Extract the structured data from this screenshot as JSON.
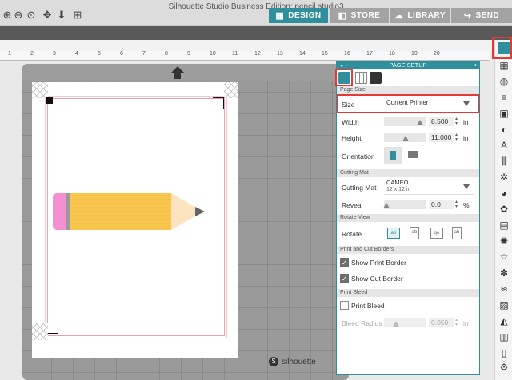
{
  "window": {
    "title": "Silhouette Studio Business Edition: pencil.studio3"
  },
  "toolbar_icons": [
    "zoom-in-icon",
    "zoom-out-icon",
    "zoom-select-icon",
    "pan-icon",
    "move-down-icon",
    "fit-to-page-icon"
  ],
  "nav_tabs": [
    {
      "label": "DESIGN",
      "icon": "grid-icon",
      "active": true,
      "color": "#2f8f9d"
    },
    {
      "label": "STORE",
      "icon": "store-icon",
      "active": false,
      "color": "#9a9a9a"
    },
    {
      "label": "LIBRARY",
      "icon": "cloud-icon",
      "active": false,
      "color": "#9a9a9a"
    },
    {
      "label": "SEND",
      "icon": "send-icon",
      "active": false,
      "color": "#9a9a9a"
    }
  ],
  "ruler": {
    "numbers": [
      "1",
      "2",
      "3",
      "4",
      "5",
      "6",
      "7",
      "8",
      "9",
      "10",
      "11",
      "12",
      "13",
      "14",
      "15",
      "16",
      "17",
      "18",
      "19",
      "20"
    ]
  },
  "brand": {
    "text": "silhouette",
    "mark": "S"
  },
  "panel": {
    "title": "PAGE SETUP",
    "close": "×",
    "minimize": "⌄",
    "sections": {
      "page_size": "Page Size",
      "cutting_mat": "Cutting Mat",
      "rotate_view": "Rotate View",
      "borders": "Print and Cut Borders",
      "bleed": "Print Bleed"
    },
    "size": {
      "label": "Size",
      "value": "Current Printer"
    },
    "width": {
      "label": "Width",
      "value": "8.500",
      "unit": "in"
    },
    "height": {
      "label": "Height",
      "value": "11.000",
      "unit": "in"
    },
    "orientation": {
      "label": "Orientation"
    },
    "cutting_mat": {
      "label": "Cutting Mat",
      "value": "CAMEO",
      "sub": "12 x 12 in"
    },
    "reveal": {
      "label": "Reveal",
      "value": "0.0",
      "unit": "%"
    },
    "rotate": {
      "label": "Rotate"
    },
    "show_print_border": {
      "label": "Show Print Border",
      "checked": true
    },
    "show_cut_border": {
      "label": "Show Cut Border",
      "checked": true
    },
    "print_bleed": {
      "label": "Print Bleed",
      "checked": false
    },
    "bleed_radius": {
      "label": "Bleed Radius",
      "value": "0.050",
      "unit": "in"
    }
  },
  "colors": {
    "accent": "#2f8f9d",
    "highlight": "#e53935",
    "pencil_body": "#f9c74f",
    "pencil_eraser": "#f48fd1"
  }
}
